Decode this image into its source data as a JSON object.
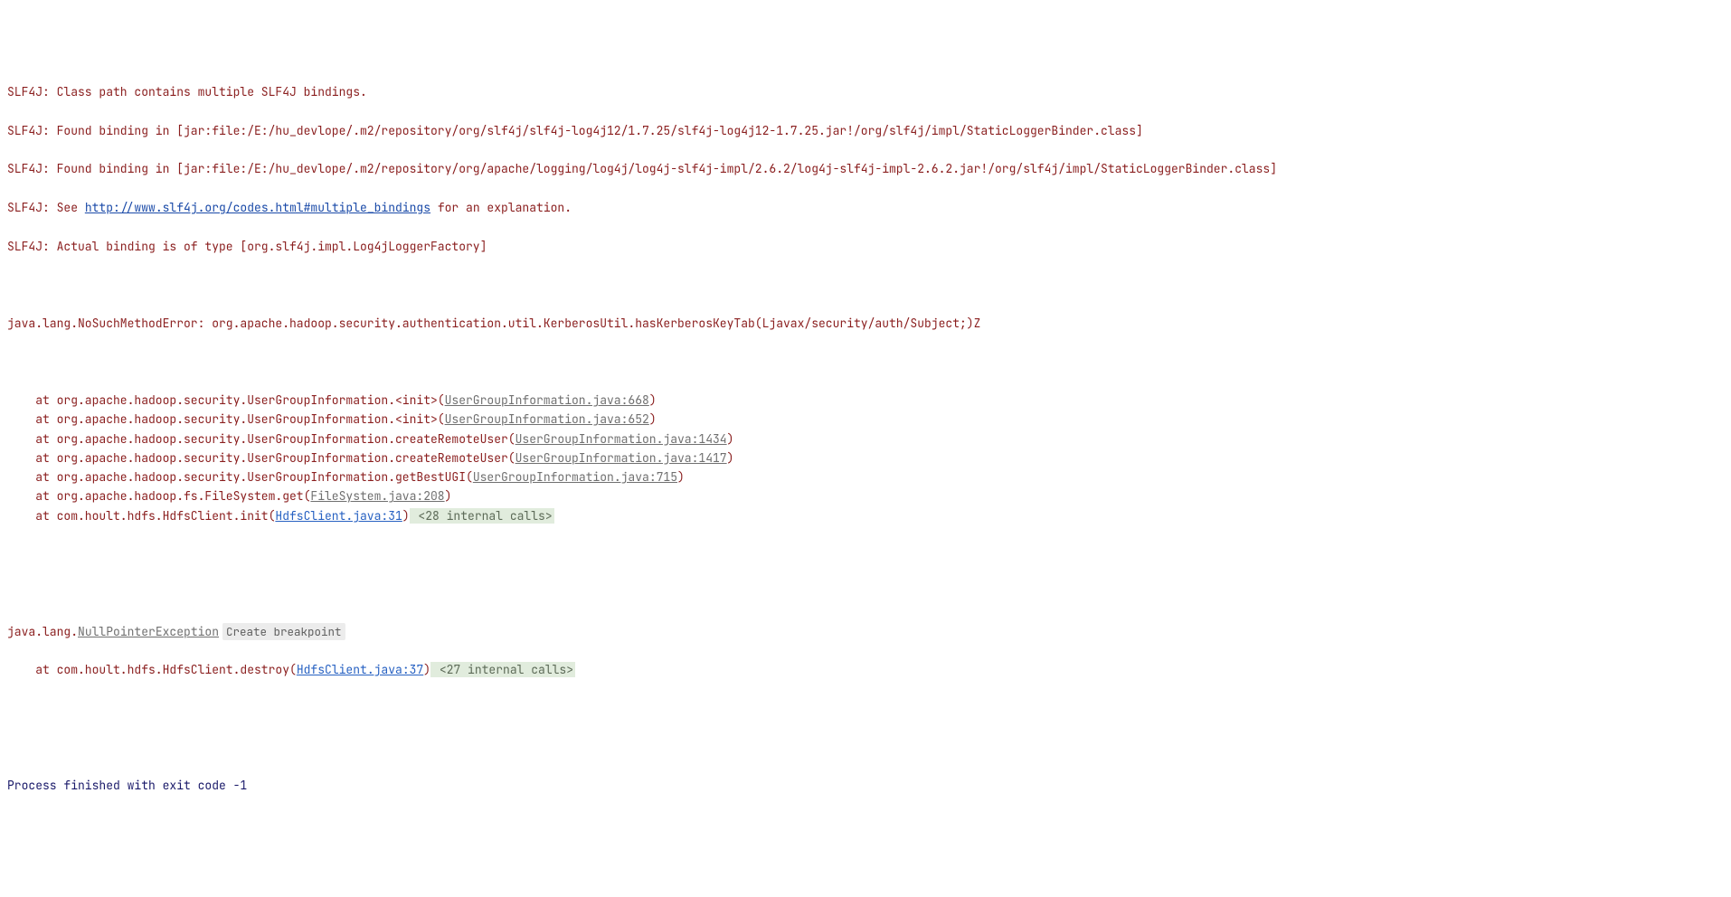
{
  "slf4j": {
    "l1": "SLF4J: Class path contains multiple SLF4J bindings.",
    "l2": "SLF4J: Found binding in [jar:file:/E:/hu_devlope/.m2/repository/org/slf4j/slf4j-log4j12/1.7.25/slf4j-log4j12-1.7.25.jar!/org/slf4j/impl/StaticLoggerBinder.class]",
    "l3": "SLF4J: Found binding in [jar:file:/E:/hu_devlope/.m2/repository/org/apache/logging/log4j/log4j-slf4j-impl/2.6.2/log4j-slf4j-impl-2.6.2.jar!/org/slf4j/impl/StaticLoggerBinder.class]",
    "l4_pre": "SLF4J: See ",
    "l4_url": "http://www.slf4j.org/codes.html#multiple_bindings",
    "l4_post": " for an explanation.",
    "l5": "SLF4J: Actual binding is of type [org.slf4j.impl.Log4jLoggerFactory]"
  },
  "error": {
    "head": "java.lang.NoSuchMethodError: org.apache.hadoop.security.authentication.util.KerberosUtil.hasKerberosKeyTab(Ljavax/security/auth/Subject;)Z"
  },
  "stack1": [
    {
      "pre": "    at org.apache.hadoop.security.UserGroupInformation.<init>(",
      "link": "UserGroupInformation.java:668",
      "post": ")",
      "kind": "gray",
      "ic": ""
    },
    {
      "pre": "    at org.apache.hadoop.security.UserGroupInformation.<init>(",
      "link": "UserGroupInformation.java:652",
      "post": ")",
      "kind": "gray",
      "ic": ""
    },
    {
      "pre": "    at org.apache.hadoop.security.UserGroupInformation.createRemoteUser(",
      "link": "UserGroupInformation.java:1434",
      "post": ")",
      "kind": "gray",
      "ic": ""
    },
    {
      "pre": "    at org.apache.hadoop.security.UserGroupInformation.createRemoteUser(",
      "link": "UserGroupInformation.java:1417",
      "post": ")",
      "kind": "gray",
      "ic": ""
    },
    {
      "pre": "    at org.apache.hadoop.security.UserGroupInformation.getBestUGI(",
      "link": "UserGroupInformation.java:715",
      "post": ")",
      "kind": "gray",
      "ic": ""
    },
    {
      "pre": "    at org.apache.hadoop.fs.FileSystem.get(",
      "link": "FileSystem.java:208",
      "post": ")",
      "kind": "gray",
      "ic": ""
    },
    {
      "pre": "    at com.hoult.hdfs.HdfsClient.init(",
      "link": "HdfsClient.java:31",
      "post": ")",
      "kind": "blue",
      "ic": " <28 internal calls>"
    }
  ],
  "npe": {
    "pre": "java.lang.",
    "link": "NullPointerException",
    "btn": "Create breakpoint"
  },
  "stack2": [
    {
      "pre": "    at com.hoult.hdfs.HdfsClient.destroy(",
      "link": "HdfsClient.java:37",
      "post": ")",
      "kind": "blue",
      "ic": " <27 internal calls>"
    }
  ],
  "exit": "Process finished with exit code -1"
}
